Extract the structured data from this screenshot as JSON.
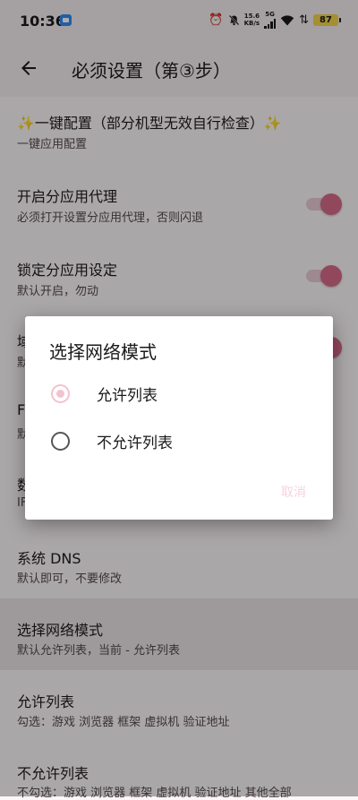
{
  "status_bar": {
    "time": "10:36",
    "speed_value": "15.6",
    "speed_unit": "KB/s",
    "network": "5G",
    "battery": "87"
  },
  "app_bar": {
    "title": "必须设置（第③步）"
  },
  "settings": [
    {
      "title": "✨一键配置（部分机型无效自行检查）✨",
      "subtitle": "一键应用配置",
      "has_switch": false
    },
    {
      "title": "开启分应用代理",
      "subtitle": "必须打开设置分应用代理，否则闪退",
      "has_switch": true,
      "switch_on": true
    },
    {
      "title": "锁定分应用设定",
      "subtitle": "默认开启，勿动",
      "has_switch": true,
      "switch_on": true
    },
    {
      "title": "域",
      "subtitle": "默",
      "has_switch": true,
      "switch_on": true
    },
    {
      "title": "F",
      "subtitle": "默",
      "has_switch": false
    },
    {
      "title": "数",
      "subtitle": "IF",
      "has_switch": false
    },
    {
      "title": "系统 DNS",
      "subtitle": "默认即可，不要修改",
      "has_switch": false
    },
    {
      "title": "选择网络模式",
      "subtitle": "默认允许列表，当前 - 允许列表",
      "has_switch": false,
      "highlighted": true
    },
    {
      "title": "允许列表",
      "subtitle": "勾选：游戏 浏览器 框架 虚拟机 验证地址",
      "has_switch": false
    },
    {
      "title": "不允许列表",
      "subtitle": "不勾选：游戏 浏览器 框架 虚拟机 验证地址 其他全部",
      "has_switch": false
    }
  ],
  "dialog": {
    "title": "选择网络模式",
    "options": [
      {
        "label": "允许列表",
        "selected": true
      },
      {
        "label": "不允许列表",
        "selected": false
      }
    ],
    "cancel_label": "取消"
  },
  "colors": {
    "accent": "#d86b88",
    "accent_light": "#f3c2cf",
    "background": "#fbf6f8"
  }
}
